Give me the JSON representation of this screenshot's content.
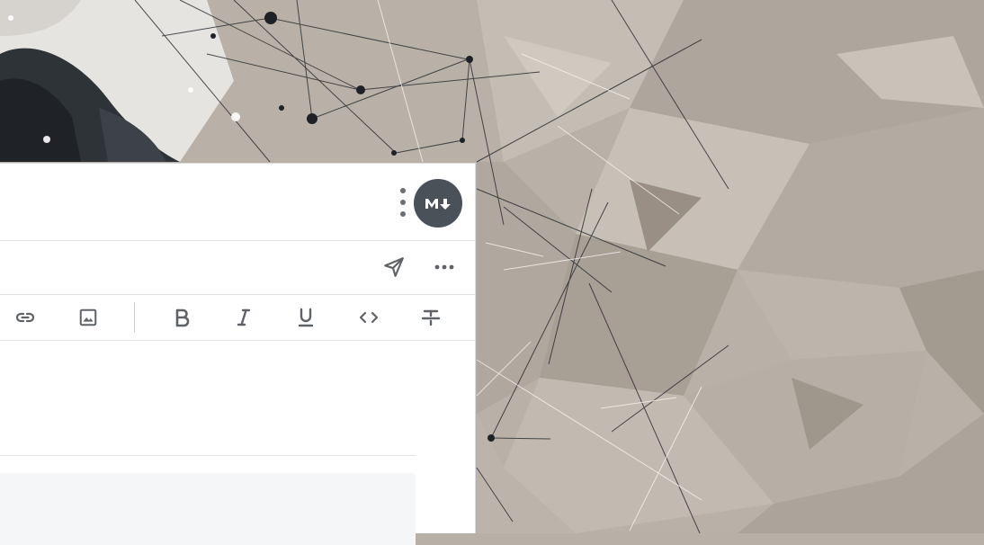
{
  "header": {
    "badge_icon": "markdown-icon",
    "badge_color": "#4a5159",
    "menu_icon": "kebab-menu-icon"
  },
  "action_bar": {
    "send_icon": "send-icon",
    "more_icon": "more-horizontal-icon"
  },
  "toolbar": {
    "items": [
      {
        "icon": "link-icon"
      },
      {
        "icon": "image-icon"
      },
      {
        "icon": "bold-icon"
      },
      {
        "icon": "italic-icon"
      },
      {
        "icon": "underline-icon"
      },
      {
        "icon": "code-icon"
      },
      {
        "icon": "strikethrough-icon"
      }
    ]
  },
  "colors": {
    "background": "#b8b0a6",
    "panel": "#ffffff",
    "icon": "#5f6368"
  }
}
